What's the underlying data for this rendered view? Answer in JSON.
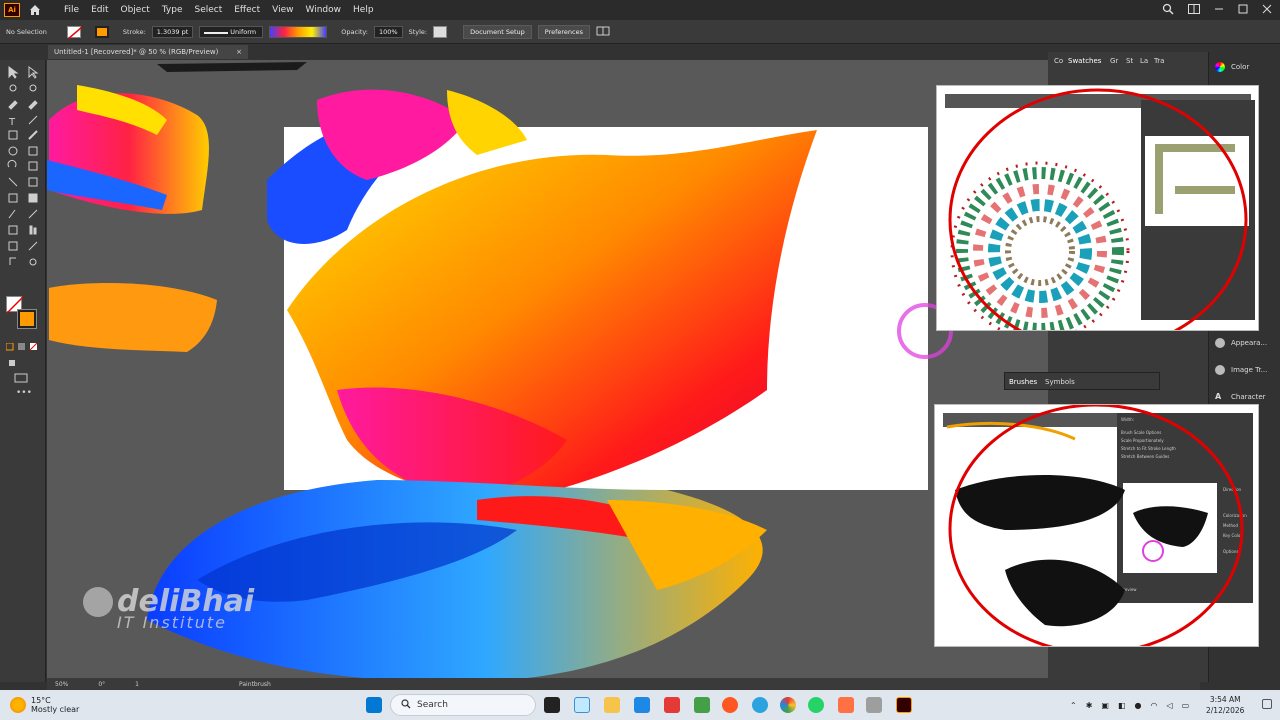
{
  "menubar": {
    "app_logo": "Ai",
    "items": [
      "File",
      "Edit",
      "Object",
      "Type",
      "Select",
      "Effect",
      "View",
      "Window",
      "Help"
    ]
  },
  "control_bar": {
    "selection": "No Selection",
    "stroke_label": "Stroke:",
    "stroke_value": "1.3039 pt",
    "stroke_profile": "Uniform",
    "opacity_label": "Opacity:",
    "opacity_value": "100%",
    "style_label": "Style:",
    "document_setup": "Document Setup",
    "preferences": "Preferences"
  },
  "document_tab": {
    "title": "Untitled-1 [Recovered]* @ 50 % (RGB/Preview)",
    "close": "×"
  },
  "status_bar": {
    "zoom": "50%",
    "rotation": "0°",
    "artboard": "1",
    "tool": "Paintbrush"
  },
  "right_panel": {
    "tabs": [
      "Co",
      "Swatches",
      "Gr",
      "St",
      "La",
      "Tra"
    ],
    "brushes_tabs": [
      "Brushes",
      "Symbols"
    ]
  },
  "side_panel": {
    "items": [
      "Color",
      "Appeara...",
      "Image Tr...",
      "Character"
    ]
  },
  "inset_bottom": {
    "dialog_items": [
      "Width:",
      "Brush Scale Options",
      "Scale Proportionately",
      "Stretch to Fit Stroke Length",
      "Stretch Between Guides",
      "Direction",
      "Colorization",
      "Method",
      "Key Color",
      "Options",
      "Preview"
    ]
  },
  "watermark": {
    "title": "deliBhai",
    "subtitle": "IT Institute"
  },
  "taskbar": {
    "temperature": "15°C",
    "weather": "Mostly clear",
    "search_placeholder": "Search",
    "time": "3:54 AM",
    "date": "2/12/2026"
  },
  "colors": {
    "accent_orange": "#ff9a00",
    "highlight_red": "#e00000",
    "cursor_magenta": "#e040e0"
  }
}
